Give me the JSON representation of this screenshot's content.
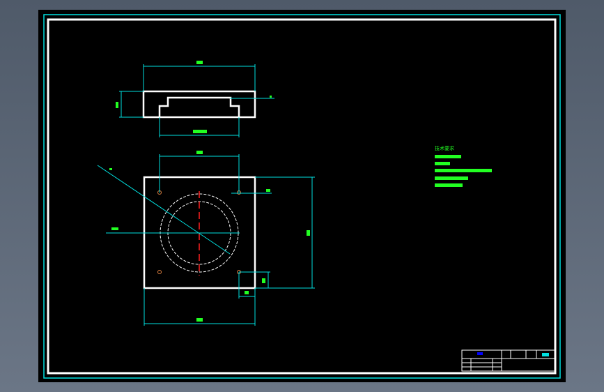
{
  "drawing": {
    "notes_title": "技术要求",
    "colors": {
      "background": "#000000",
      "outline": "#ffffff",
      "dimension": "#00ffff",
      "text": "#22ff22",
      "centerline": "#ff0000",
      "title_text": "#0000ff"
    }
  }
}
